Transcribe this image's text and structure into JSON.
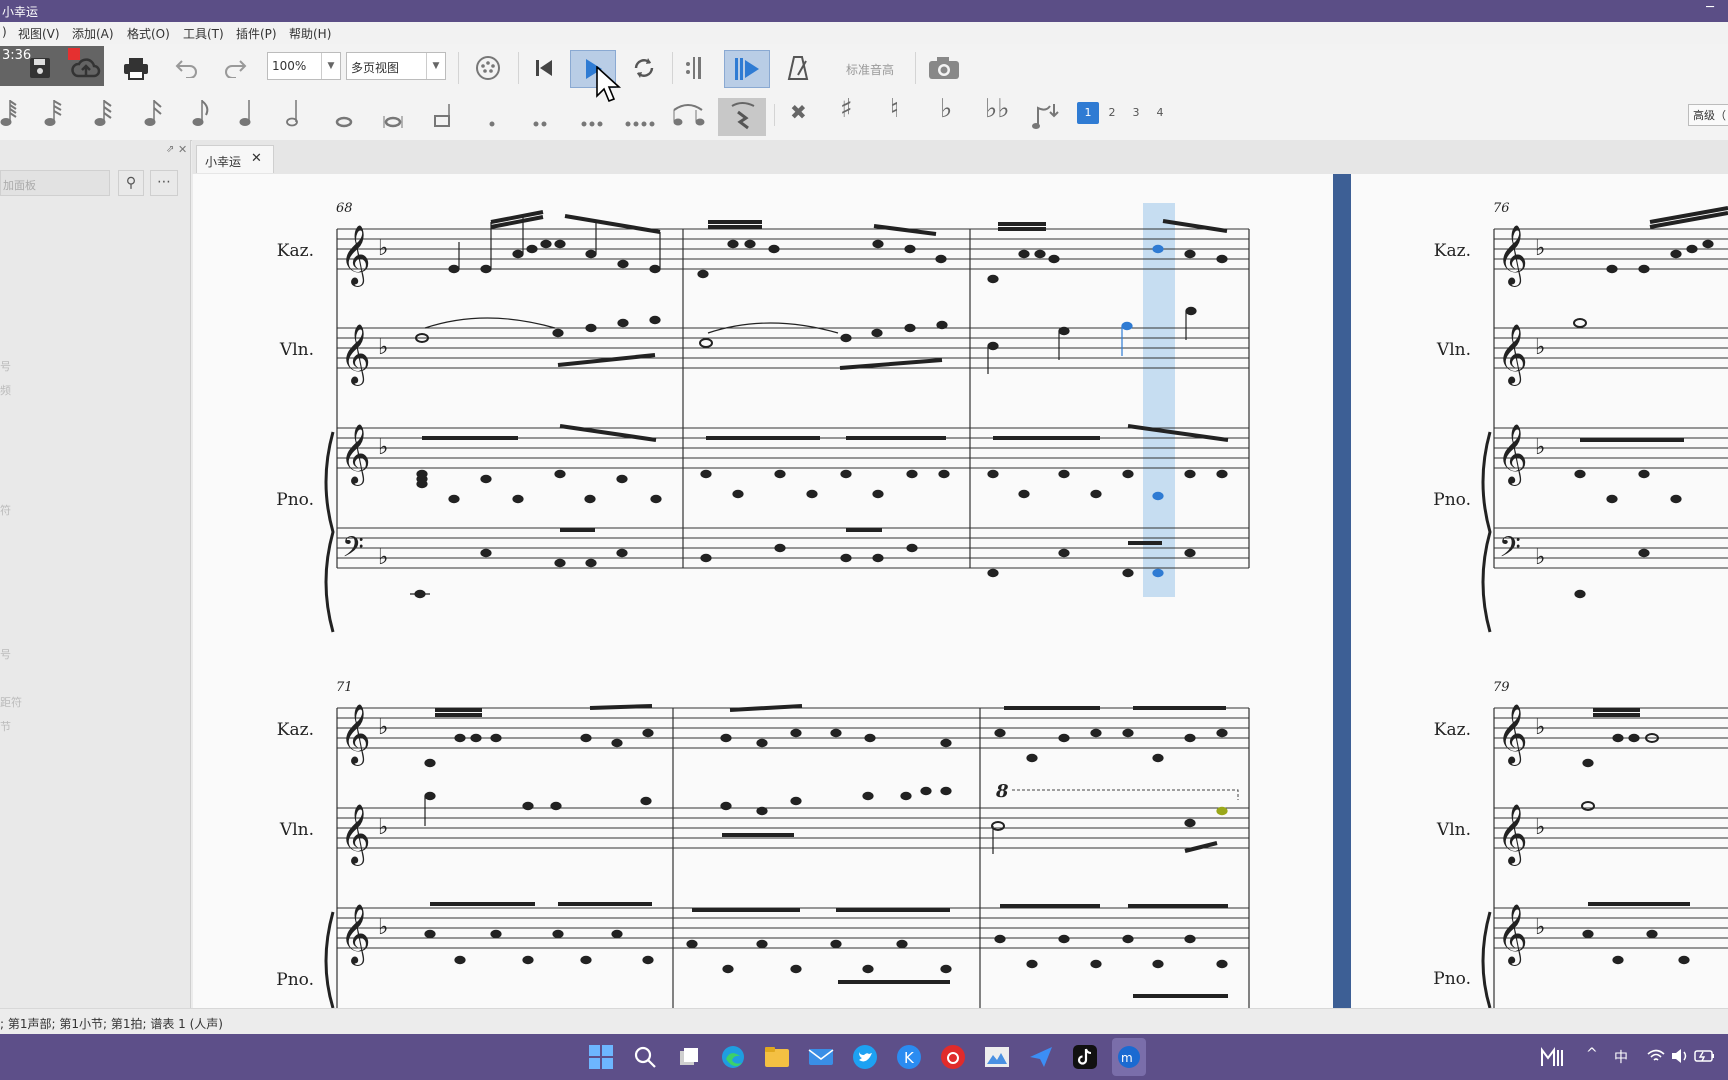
{
  "window": {
    "title": "小幸运",
    "minimize_glyph": "─"
  },
  "menubar": {
    "items": [
      ")",
      "视图(V)",
      "添加(A)",
      "格式(O)",
      "工具(T)",
      "插件(P)",
      "帮助(H)"
    ]
  },
  "toolbar": {
    "timer": "3:36",
    "zoom_value": "100%",
    "view_mode": "多页视图",
    "pitch_label": "标准音高"
  },
  "palette": {
    "voice_numbers": [
      "1",
      "2",
      "3",
      "4"
    ],
    "advanced_label": "高级（"
  },
  "leftpanel": {
    "search_placeholder": "加面板",
    "labels": [
      "号",
      "频",
      "符",
      "号",
      "距符",
      "节"
    ]
  },
  "tab": {
    "title": "小幸运",
    "close_glyph": "✕"
  },
  "score": {
    "measure_numbers": [
      "68",
      "71",
      "76",
      "79"
    ],
    "ottava_label": "8",
    "instruments": [
      "Kaz.",
      "Vln.",
      "Pno."
    ]
  },
  "status": {
    "text": "; 第1声部;  第1小节; 第1拍; 谱表 1 (人声)"
  },
  "taskbar": {
    "ime": "中"
  },
  "colors": {
    "titlebar": "#5b4e86",
    "taskbar": "#5d4f89",
    "accent_blue": "#2f7bd3",
    "selection": "#bcd7ee",
    "page_divider": "#3d5f95"
  }
}
